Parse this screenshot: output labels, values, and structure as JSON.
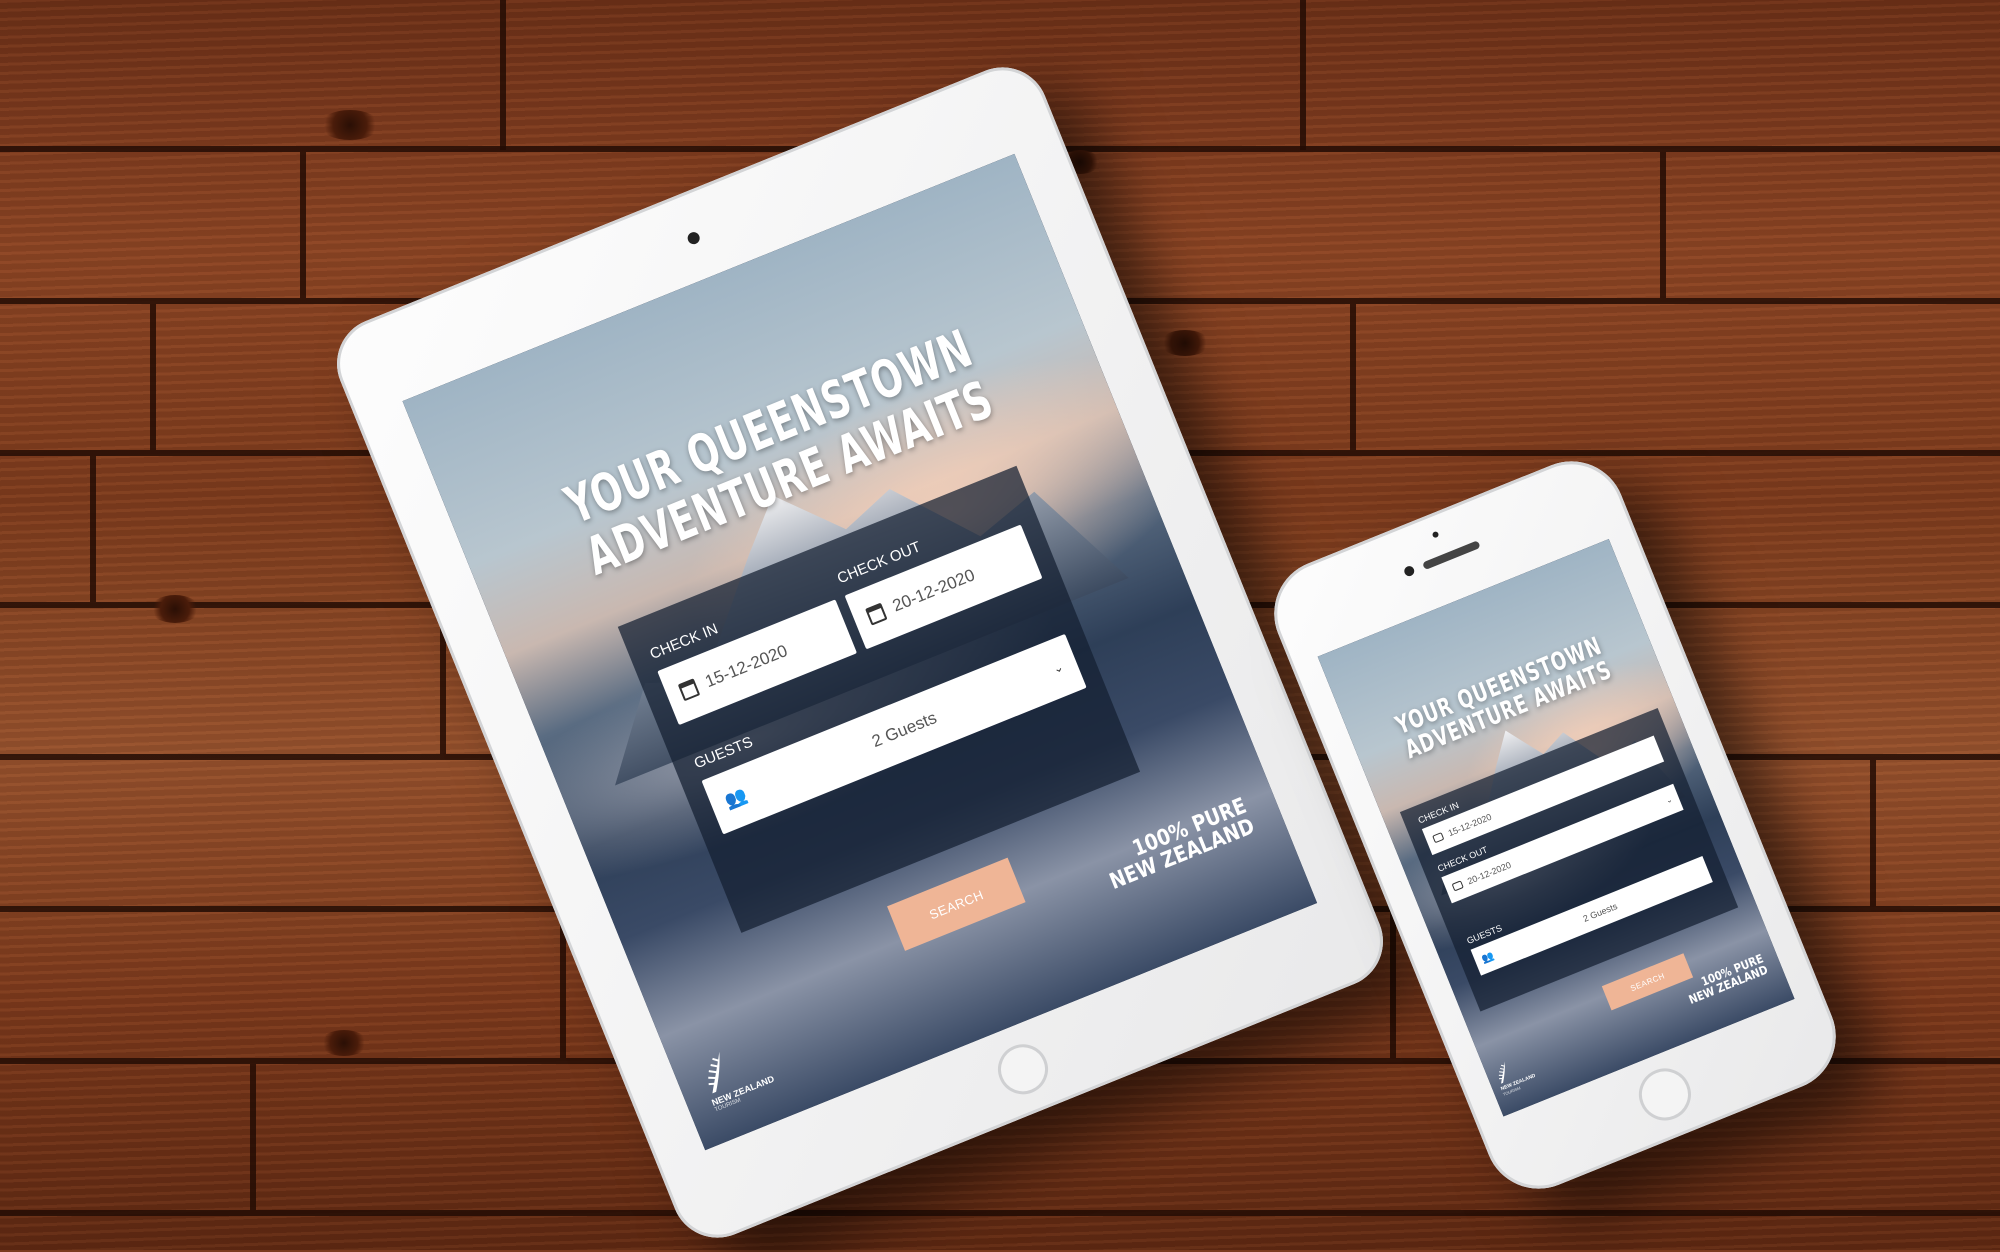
{
  "headline": {
    "line1": "YOUR QUEENSTOWN",
    "line2": "ADVENTURE AWAITS"
  },
  "form": {
    "check_in_label": "CHECK IN",
    "check_in_value": "15-12-2020",
    "check_out_label": "CHECK OUT",
    "check_out_value": "20-12-2020",
    "guests_label": "GUESTS",
    "guests_value": "2 Guests",
    "search_label": "SEARCH"
  },
  "branding": {
    "pure_line1": "100% PURE",
    "pure_line2": "NEW ZEALAND",
    "logo_text": "NEW ZEALAND",
    "logo_sub": "TOURISM"
  },
  "icons": {
    "calendar": "calendar-icon",
    "guests": "people-icon",
    "dropdown": "chevron-down-icon",
    "logo": "fern-icon"
  },
  "colors": {
    "accent": "#efb596",
    "panel": "#141e30",
    "text_light": "#ffffff"
  }
}
